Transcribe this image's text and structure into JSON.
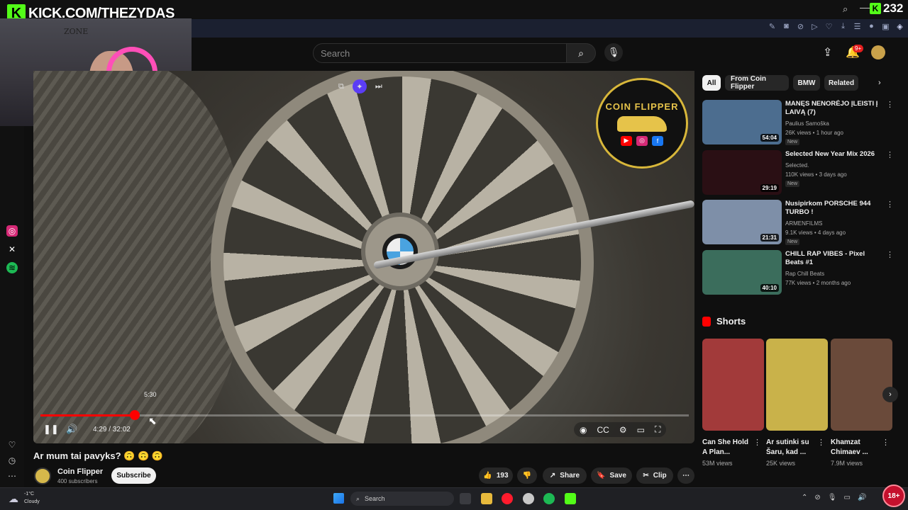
{
  "stream": {
    "kick_label": "KICK.COM/THEZYDAS",
    "kick_logo_letter": "K",
    "viewer_count": "232"
  },
  "webcam": {
    "sign_text": "ZONE"
  },
  "youtube": {
    "search_placeholder": "Search",
    "notification_badge": "9+"
  },
  "video": {
    "title": "Ar mum tai pavyks? 🙃 🙃 🙃",
    "progress_fraction": 0.145,
    "current_time": "4:29",
    "duration": "32:02",
    "time_display": "4:29 / 32:02",
    "hover_time": "5:30",
    "overlay_logo_text": "COIN FLIPPER"
  },
  "channel": {
    "name": "Coin Flipper",
    "subscribers": "400 subscribers",
    "subscribe_label": "Subscribe"
  },
  "actions": {
    "like_count": "193",
    "share_label": "Share",
    "save_label": "Save",
    "clip_label": "Clip"
  },
  "chips": [
    "All",
    "From Coin Flipper",
    "BMW",
    "Related"
  ],
  "recommendations": [
    {
      "title": "MANĘS NENORĖJO ĮLEISTI Į LAIVĄ (7)",
      "channel": "Paulius Samoška",
      "meta": "26K views • 1 hour ago",
      "duration": "54:04",
      "badge": "New",
      "thumb_color": "#4c6d8f"
    },
    {
      "title": "Selected New Year Mix 2026",
      "channel": "Selected.",
      "meta": "110K views • 3 days ago",
      "duration": "29:19",
      "badge": "New",
      "thumb_color": "#2a0f14"
    },
    {
      "title": "Nusipirkom PORSCHE 944 TURBO !",
      "channel": "ARMENFILMS",
      "meta": "9.1K views • 4 days ago",
      "duration": "21:31",
      "badge": "New",
      "thumb_color": "#7e8fa8"
    },
    {
      "title": "CHILL RAP VIBES - Pixel Beats #1",
      "channel": "Rap Chill Beats",
      "meta": "77K views • 2 months ago",
      "duration": "40:10",
      "badge": "",
      "thumb_color": "#3b6d5c"
    }
  ],
  "shorts": {
    "header": "Shorts",
    "items": [
      {
        "title": "Can She Hold A Plan...",
        "views": "53M views",
        "thumb_color": "#a23a3a"
      },
      {
        "title": "Ar sutinki su Šaru, kad ...",
        "views": "25K views",
        "thumb_color": "#c9b24a"
      },
      {
        "title": "Khamzat Chimaev ...",
        "views": "7.9M views",
        "thumb_color": "#6a4a3a"
      }
    ]
  },
  "taskbar": {
    "temperature": "-1°C",
    "weather": "Cloudy",
    "search_label": "Search"
  },
  "badge_18": "18+",
  "colors": {
    "kick_green": "#53fc18",
    "youtube_red": "#ff0000",
    "coin_gold": "#e6c34a"
  }
}
